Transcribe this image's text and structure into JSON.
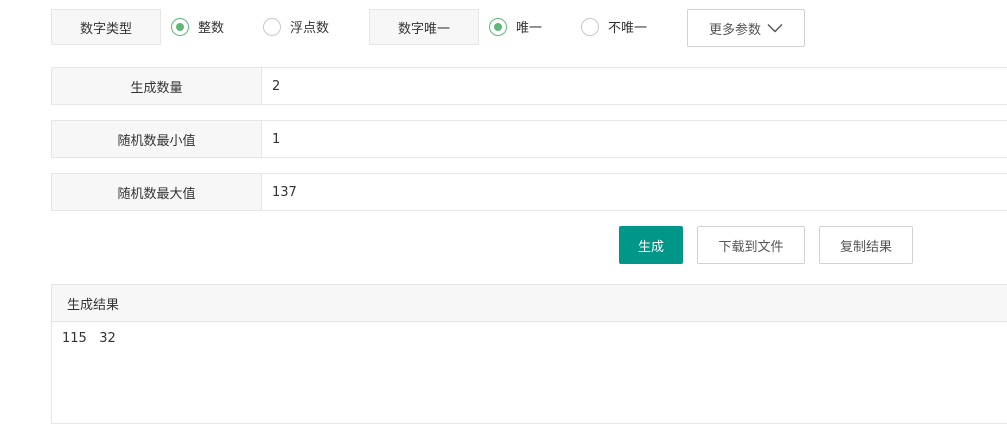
{
  "options": {
    "type_label": "数字类型",
    "type_choices": [
      {
        "label": "整数",
        "selected": true
      },
      {
        "label": "浮点数",
        "selected": false
      }
    ],
    "unique_label": "数字唯一",
    "unique_choices": [
      {
        "label": "唯一",
        "selected": true
      },
      {
        "label": "不唯一",
        "selected": false
      }
    ],
    "more_label": "更多参数"
  },
  "fields": [
    {
      "label": "生成数量",
      "value": "2"
    },
    {
      "label": "随机数最小值",
      "value": "1"
    },
    {
      "label": "随机数最大值",
      "value": "137"
    }
  ],
  "actions": {
    "generate": "生成",
    "download": "下载到文件",
    "copy": "复制结果"
  },
  "result": {
    "title": "生成结果",
    "content": "115   32"
  },
  "colors": {
    "primary": "#009688",
    "radio_active": "#5fb878"
  }
}
